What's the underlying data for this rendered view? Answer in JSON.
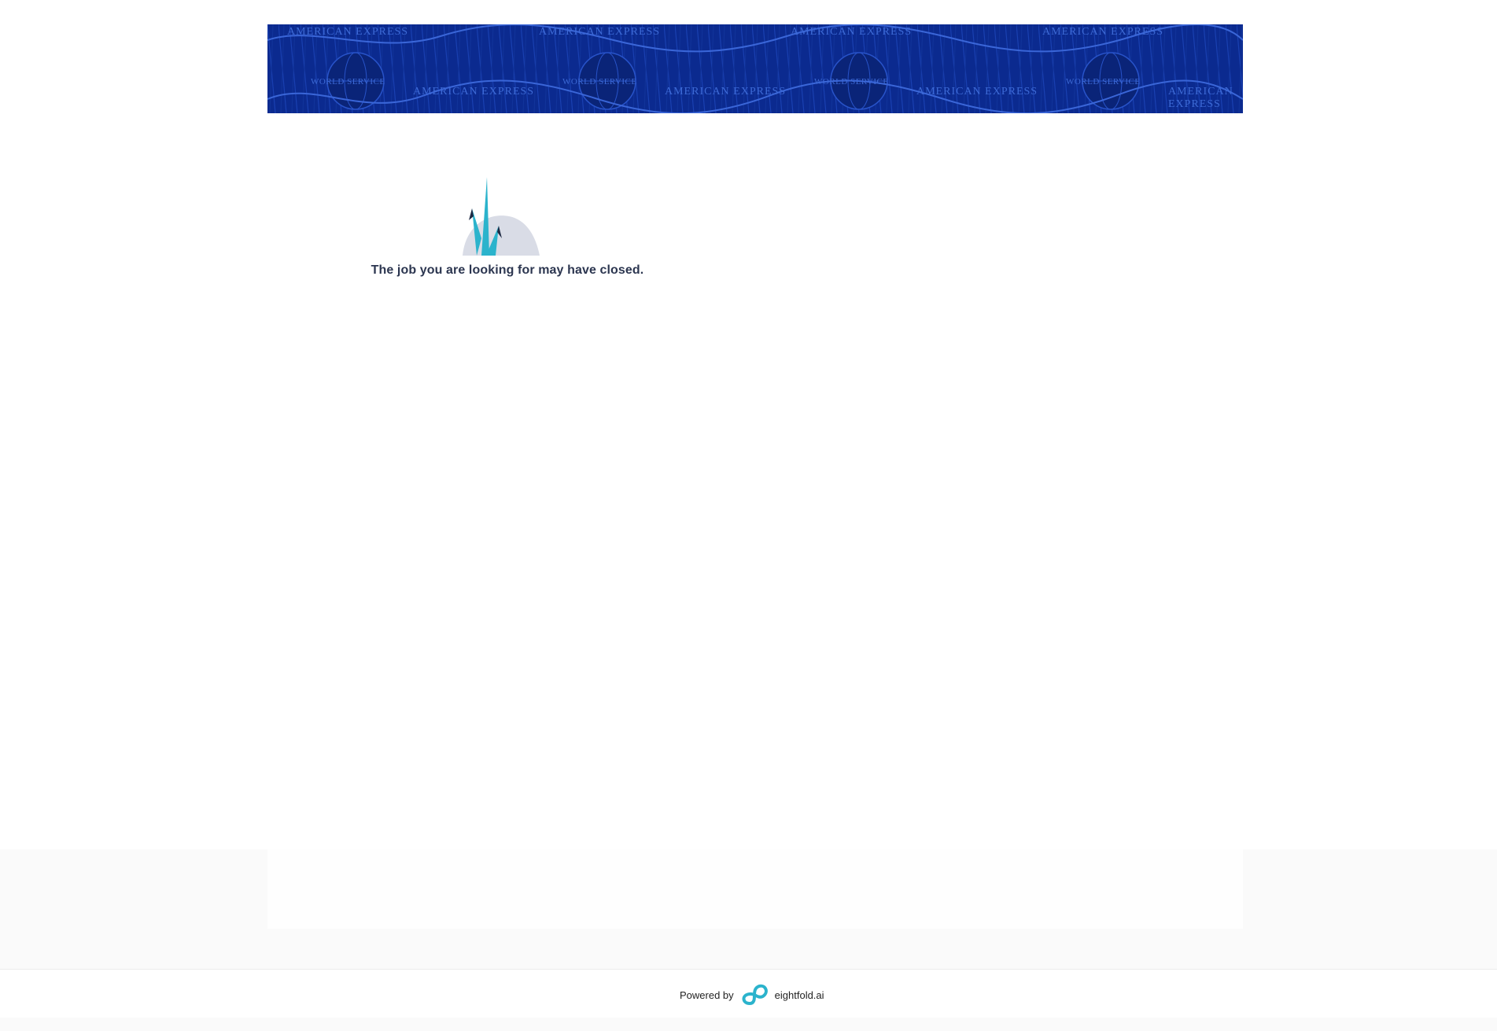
{
  "banner": {
    "brand_text": "AMERICAN EXPRESS",
    "tagline_text": "WORLD SERVICE",
    "background_color": "#0b2a8f"
  },
  "main": {
    "illustration_icon": "origami-crane-icon",
    "message": "The job you are looking for may have closed."
  },
  "footer": {
    "powered_by_label": "Powered by",
    "provider_name": "eightfold.ai",
    "provider_logo_icon": "eightfold-infinity-icon"
  },
  "colors": {
    "accent_teal": "#2bb3cc",
    "text_dark": "#2c3650",
    "band_grey": "#fafafa"
  }
}
